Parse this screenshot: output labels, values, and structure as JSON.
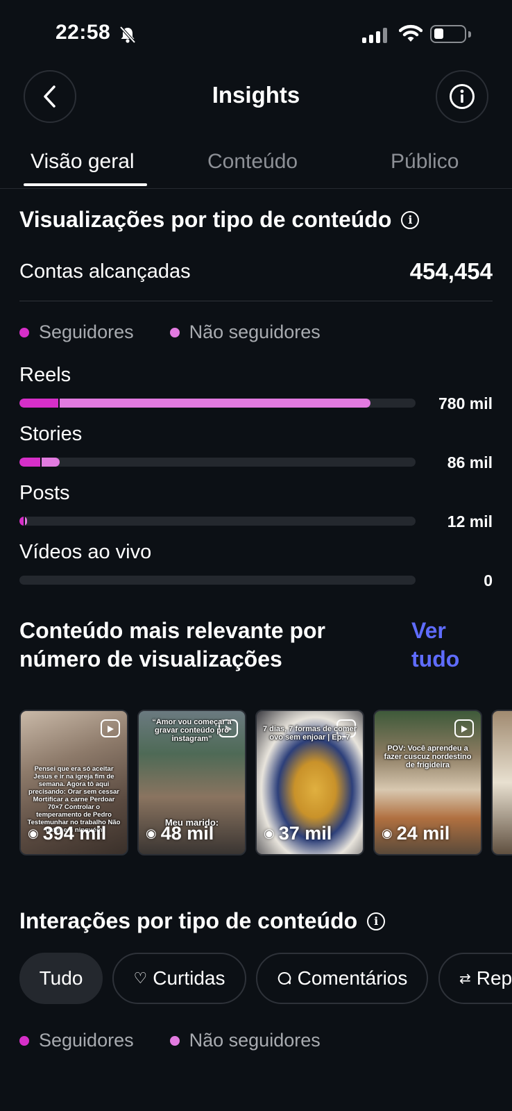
{
  "status_bar": {
    "time": "22:58"
  },
  "header": {
    "title": "Insights"
  },
  "tabs": [
    {
      "label": "Visão geral"
    },
    {
      "label": "Conteúdo"
    },
    {
      "label": "Público"
    }
  ],
  "views_section": {
    "title": "Visualizações por tipo de conteúdo",
    "reach_label": "Contas alcançadas",
    "reach_value": "454,454",
    "legend": [
      {
        "label": "Seguidores",
        "color": "#d62fc8"
      },
      {
        "label": "Não seguidores",
        "color": "#e27be0"
      }
    ],
    "bars": [
      {
        "label": "Reels",
        "value_label": "780 mil",
        "followers_pct": 9.8,
        "non_followers_pct": 78.9
      },
      {
        "label": "Stories",
        "value_label": "86 mil",
        "followers_pct": 5.3,
        "non_followers_pct": 4.8
      },
      {
        "label": "Posts",
        "value_label": "12 mil",
        "followers_pct": 1.0,
        "non_followers_pct": 1.0
      },
      {
        "label": "Vídeos ao vivo",
        "value_label": "0",
        "followers_pct": 0,
        "non_followers_pct": 0
      }
    ]
  },
  "top_content": {
    "title": "Conteúdo mais relevante por número de visualizações",
    "see_all": "Ver tudo",
    "items": [
      {
        "views": "394 mil",
        "caption": "Pensei que era só aceitar Jesus e ir na igreja fim de semana. Agora tô aqui precisando: Orar sem cessar Mortificar a carne Perdoar 70×7 Controlar o temperamento de Pedro Testemunhar no trabalho Não bater em ninguém"
      },
      {
        "views": "48 mil",
        "caption": "“Amor vou começar a gravar conteúdo pro instagram”",
        "subcaption": "Meu marido:"
      },
      {
        "views": "37 mil",
        "caption": "7 dias, 7 formas de comer ovo sem enjoar | Ep. 7"
      },
      {
        "views": "24 mil",
        "caption": "POV: Você aprendeu a fazer cuscuz nordestino de frigideira"
      }
    ]
  },
  "interactions_section": {
    "title": "Interações por tipo de conteúdo",
    "chips": [
      {
        "label": "Tudo",
        "icon": ""
      },
      {
        "label": "Curtidas",
        "icon": "heart-icon"
      },
      {
        "label": "Comentários",
        "icon": "comment-icon"
      },
      {
        "label": "Rep",
        "icon": "repost-icon"
      }
    ],
    "legend": [
      {
        "label": "Seguidores",
        "color": "#d62fc8"
      },
      {
        "label": "Não seguidores",
        "color": "#e27be0"
      }
    ]
  }
}
